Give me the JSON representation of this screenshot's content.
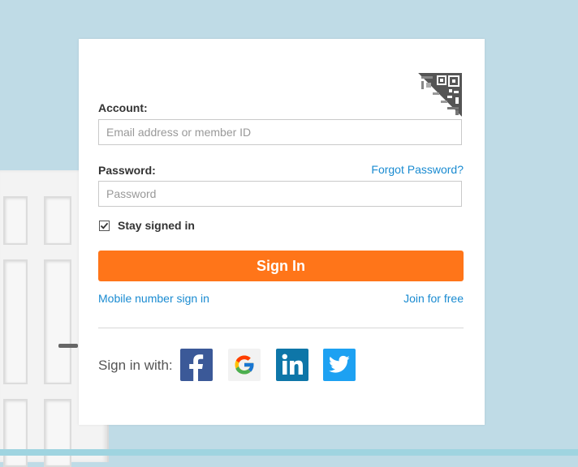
{
  "form": {
    "account_label": "Account:",
    "account_placeholder": "Email address or member ID",
    "account_value": "",
    "password_label": "Password:",
    "forgot_password": "Forgot Password?",
    "password_placeholder": "Password",
    "password_value": "",
    "stay_signed_in_label": "Stay signed in",
    "stay_signed_in_checked": true,
    "sign_in_button": "Sign In"
  },
  "links": {
    "mobile_sign_in": "Mobile number sign in",
    "join_free": "Join for free"
  },
  "social": {
    "label": "Sign in with:",
    "providers": [
      "facebook",
      "google",
      "linkedin",
      "twitter"
    ]
  },
  "colors": {
    "primary_button": "#ff7519",
    "link": "#1a8bd1",
    "facebook": "#3b5998",
    "linkedin": "#0e76a8",
    "twitter": "#1da1f2",
    "background": "#bfdbe6"
  }
}
